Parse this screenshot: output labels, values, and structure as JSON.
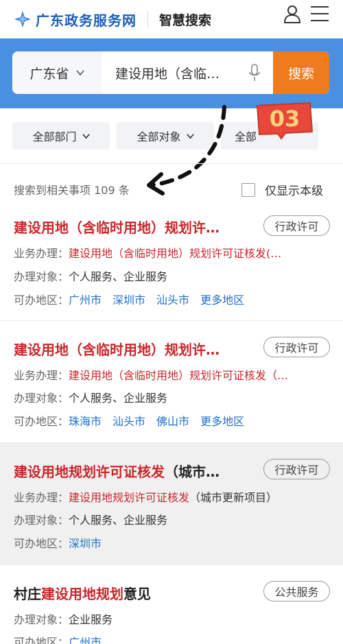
{
  "header": {
    "brand": "广东政务服务网",
    "subbrand": "智慧搜索"
  },
  "search": {
    "province": "广东省",
    "query": "建设用地（含临…",
    "button": "搜索"
  },
  "filters": [
    "全部部门",
    "全部对象",
    "全部"
  ],
  "badge": "03",
  "summary": {
    "text": "搜索到相关事项 109 条",
    "only_province": "仅显示本级"
  },
  "results": [
    {
      "title_red": "建设用地（含临时用地）规划许…",
      "tag": "行政许可",
      "business_label": "业务办理：",
      "business_value": "建设用地（含临时用地）规划许可证核发(…",
      "target_label": "办理对象：",
      "target_value": "个人服务、企业服务",
      "region_label": "可办地区：",
      "regions": [
        "广州市",
        "深圳市",
        "汕头市",
        "更多地区"
      ]
    },
    {
      "title_red": "建设用地（含临时用地）规划许…",
      "tag": "行政许可",
      "business_label": "业务办理：",
      "business_value": "建设用地（含临时用地）规划许可证核发（…",
      "target_label": "办理对象：",
      "target_value": "个人服务、企业服务",
      "region_label": "可办地区：",
      "regions": [
        "珠海市",
        "汕头市",
        "佛山市",
        "更多地区"
      ]
    },
    {
      "title_red": "建设用地规划许可证核发",
      "title_black": "（城市…",
      "tag": "行政许可",
      "business_label": "业务办理：",
      "business_red": "建设用地规划许可证核发",
      "business_black": "（城市更新项目）",
      "target_label": "办理对象：",
      "target_value": "个人服务、企业服务",
      "region_label": "可办地区：",
      "regions": [
        "深圳市"
      ]
    },
    {
      "title_black_1": "村庄",
      "title_red": "建设用地规划",
      "title_black_2": "意见",
      "tag": "公共服务",
      "target_label": "办理对象：",
      "target_value": "企业服务",
      "region_label": "可办地区：",
      "regions": [
        "广州市"
      ]
    }
  ],
  "colors": {
    "brand_blue": "#1d5fb4",
    "search_band": "#4a90e2",
    "search_button": "#ef7b1e",
    "highlight_red": "#c8262b",
    "link_blue": "#1d6fc9"
  }
}
